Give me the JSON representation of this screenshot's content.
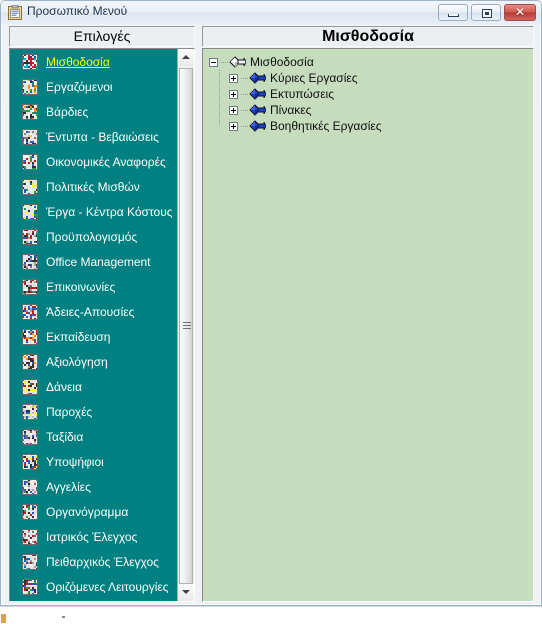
{
  "window": {
    "title": "Προσωπικό Μενού",
    "icon": "clipboard-icon",
    "controls": {
      "minimize": "minimize-icon",
      "maximize": "maximize-icon",
      "close": "✕"
    }
  },
  "left_panel": {
    "header": "Επιλογές",
    "selected_index": 0,
    "items": [
      {
        "label": "Μισθοδοσία",
        "icon": "payroll-icon"
      },
      {
        "label": "Εργαζόμενοι",
        "icon": "employees-icon"
      },
      {
        "label": "Βάρδιες",
        "icon": "shifts-icon"
      },
      {
        "label": "Έντυπα - Βεβαιώσεις",
        "icon": "forms-icon"
      },
      {
        "label": "Οικονομικές Αναφορές",
        "icon": "financial-reports-icon"
      },
      {
        "label": "Πολιτικές Μισθών",
        "icon": "salary-policies-icon"
      },
      {
        "label": "Έργα - Κέντρα Κόστους",
        "icon": "projects-cost-centers-icon"
      },
      {
        "label": "Προϋπολογισμός",
        "icon": "budget-icon"
      },
      {
        "label": "Office Management",
        "icon": "office-management-icon"
      },
      {
        "label": "Επικοινωνίες",
        "icon": "communications-icon"
      },
      {
        "label": "Άδειες-Απουσίες",
        "icon": "leaves-absences-icon"
      },
      {
        "label": "Εκπαίδευση",
        "icon": "training-icon"
      },
      {
        "label": "Αξιολόγηση",
        "icon": "evaluation-icon"
      },
      {
        "label": "Δάνεια",
        "icon": "loans-icon"
      },
      {
        "label": "Παροχές",
        "icon": "benefits-icon"
      },
      {
        "label": "Ταξίδια",
        "icon": "travel-icon"
      },
      {
        "label": "Υποψήφιοι",
        "icon": "candidates-icon"
      },
      {
        "label": "Αγγελίες",
        "icon": "job-ads-icon"
      },
      {
        "label": "Οργανόγραμμα",
        "icon": "org-chart-icon"
      },
      {
        "label": "Ιατρικός Έλεγχος",
        "icon": "medical-check-icon"
      },
      {
        "label": "Πειθαρχικός Έλεγχος",
        "icon": "disciplinary-check-icon"
      },
      {
        "label": "Οριζόμενες Λειτουργίες",
        "icon": "custom-functions-icon"
      }
    ],
    "scrollbar": {
      "up_arrow": "scroll-up-icon",
      "down_arrow": "scroll-down-icon"
    }
  },
  "right_panel": {
    "header": "Μισθοδοσία",
    "tree": {
      "root": {
        "label": "Μισθοδοσία",
        "expanded": true,
        "toggle": "−",
        "icon": "node-root-icon"
      },
      "children": [
        {
          "label": "Κύριες Εργασίες",
          "expanded": false,
          "toggle": "+",
          "icon": "node-item-icon"
        },
        {
          "label": "Εκτυπώσεις",
          "expanded": false,
          "toggle": "+",
          "icon": "node-item-icon"
        },
        {
          "label": "Πίνακες",
          "expanded": false,
          "toggle": "+",
          "icon": "node-item-icon"
        },
        {
          "label": "Βοηθητικές Εργασίες",
          "expanded": false,
          "toggle": "+",
          "icon": "node-item-icon"
        }
      ]
    }
  },
  "colors": {
    "list_background": "#008080",
    "tree_background": "#c5ddbd",
    "selected_text": "#ffff00",
    "list_text": "#ffffff",
    "title_text": "#15314e",
    "close_button": "#b83c36"
  }
}
